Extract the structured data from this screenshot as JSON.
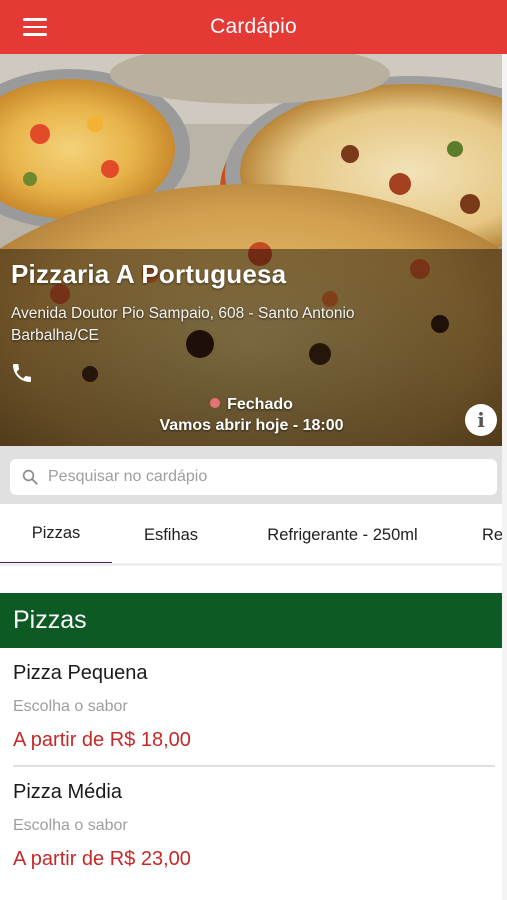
{
  "app_bar": {
    "title": "Cardápio",
    "menu_icon": "hamburger-menu-icon",
    "color": "#e53935"
  },
  "store": {
    "name": "Pizzaria A Portuguesa",
    "address_line1": "Avenida Doutor Pio Sampaio, 608 - Santo Antonio",
    "address_line2": "Barbalha/CE",
    "phone_icon": "phone-icon",
    "status": "Fechado",
    "status_color": "#e57373",
    "opening": "Vamos abrir hoje - 18:00",
    "info_icon": "info-icon"
  },
  "search": {
    "placeholder": "Pesquisar no cardápio",
    "icon": "search-icon"
  },
  "tabs": [
    {
      "label": "Pizzas",
      "active": true
    },
    {
      "label": "Esfihas",
      "active": false
    },
    {
      "label": "Refrigerante - 250ml",
      "active": false
    },
    {
      "label": "Ref",
      "active": false
    }
  ],
  "section": {
    "title": "Pizzas",
    "color": "#0d5a24"
  },
  "products": [
    {
      "name": "Pizza Pequena",
      "description": "Escolha o sabor",
      "price": "A partir de R$ 18,00"
    },
    {
      "name": "Pizza Média",
      "description": "Escolha o sabor",
      "price": "A partir de R$ 23,00"
    }
  ],
  "colors": {
    "price": "#c62828",
    "tab_indicator": "#4a235a"
  }
}
